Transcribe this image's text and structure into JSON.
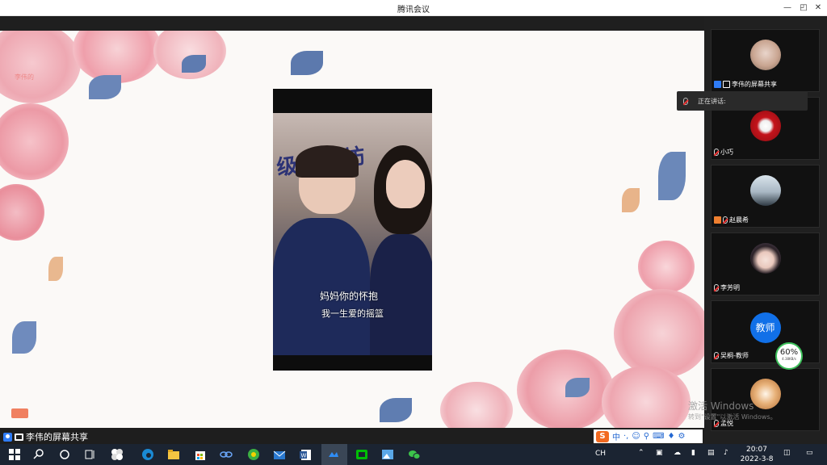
{
  "window": {
    "title": "腾讯会议",
    "controls": [
      "—",
      "◰",
      "▢",
      "✕"
    ]
  },
  "share": {
    "watermark_name": "李伟的",
    "label": "李伟的屏幕共享",
    "lyric_line1": "妈妈你的怀抱",
    "lyric_line2": "我一生爱的摇篮",
    "banner": "级工作坊"
  },
  "ime": {
    "logo": "S",
    "mode": "中"
  },
  "speaking": {
    "label": "正在讲话:"
  },
  "participants": [
    {
      "name": "李伟的屏幕共享",
      "muted": false
    },
    {
      "name": "小巧",
      "muted": true
    },
    {
      "name": "赵晨希",
      "muted": true
    },
    {
      "name": "李芳明",
      "muted": true
    },
    {
      "name": "吴桐-教师",
      "muted": true,
      "avatar_text": "教师"
    },
    {
      "name": "孟悦",
      "muted": true
    }
  ],
  "network": {
    "percent": "60%",
    "speed": "4.38KB/s"
  },
  "activation": {
    "line1": "激活 Windows",
    "line2": "转到\"设置\"以激活 Windows。"
  },
  "taskbar": {
    "lang": "CH",
    "time": "20:07",
    "date": "2022-3-8"
  },
  "colors": {
    "accent": "#2f7cf6",
    "panel_bg": "#202020",
    "taskbar_bg": "#1b2432",
    "rose": "#f2b8c0",
    "teacher_blue": "#1170e8"
  }
}
